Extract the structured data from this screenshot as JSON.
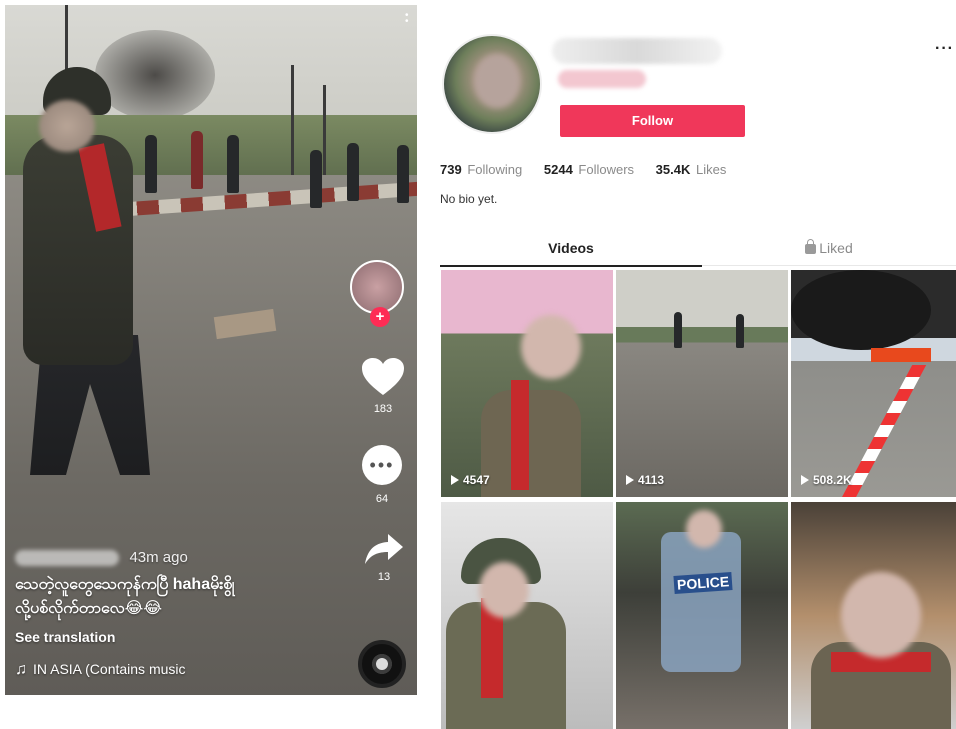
{
  "video": {
    "time_ago": "43m ago",
    "caption_line1": "သေတဲ့လူတွေသေကုန်ကပြီ hahaမိုးစွို",
    "caption_line2": "လို့ပစ်လိုက်တာလေ😂😂",
    "see_translation": "See translation",
    "music": "IN ASIA (Contains music",
    "likes": "183",
    "comments": "64",
    "shares": "13"
  },
  "profile": {
    "follow_label": "Follow",
    "more_label": "···",
    "stats": [
      {
        "value": "739",
        "label": "Following"
      },
      {
        "value": "5244",
        "label": "Followers"
      },
      {
        "value": "35.4K",
        "label": "Likes"
      }
    ],
    "bio": "No bio yet.",
    "tabs": {
      "videos": "Videos",
      "liked": "Liked"
    },
    "videos": [
      {
        "views": "4547"
      },
      {
        "views": "4113"
      },
      {
        "views": "508.2K"
      },
      {
        "views": ""
      },
      {
        "views": ""
      },
      {
        "views": ""
      }
    ],
    "police_label": "POLICE"
  },
  "colors": {
    "accent": "#f0375a",
    "tiktok_red": "#fe2c55"
  }
}
